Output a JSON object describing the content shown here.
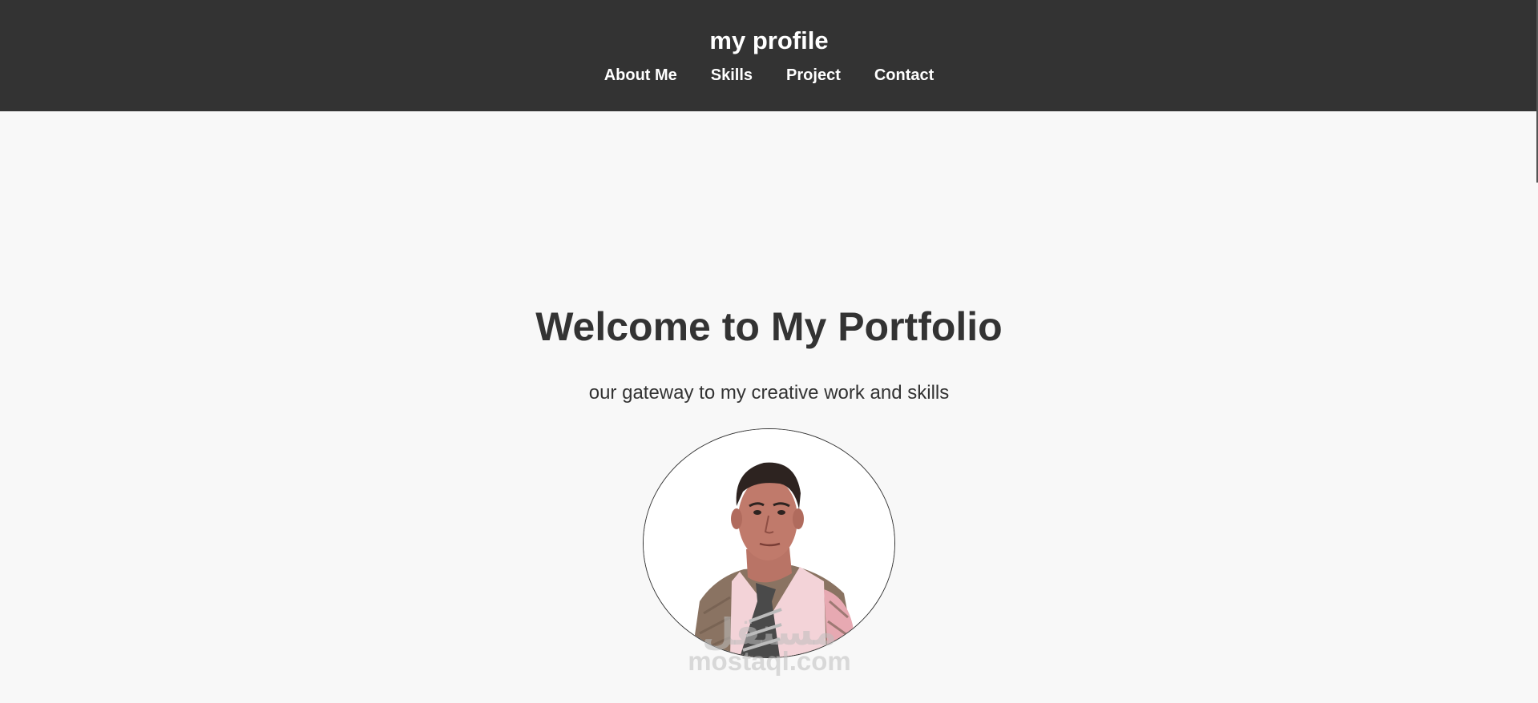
{
  "header": {
    "title": "my profile",
    "nav": [
      {
        "label": "About Me"
      },
      {
        "label": "Skills"
      },
      {
        "label": "Project"
      },
      {
        "label": "Contact"
      }
    ]
  },
  "hero": {
    "title": "Welcome to My Portfolio",
    "subtitle": "our gateway to my creative work and skills"
  },
  "profile_photo": {
    "alt": "profile photo"
  },
  "watermark": {
    "logo": "مستقل",
    "text": "mostaql.com"
  },
  "colors": {
    "header_bg": "#333333",
    "page_bg": "#f8f8f8",
    "text": "#333333"
  }
}
